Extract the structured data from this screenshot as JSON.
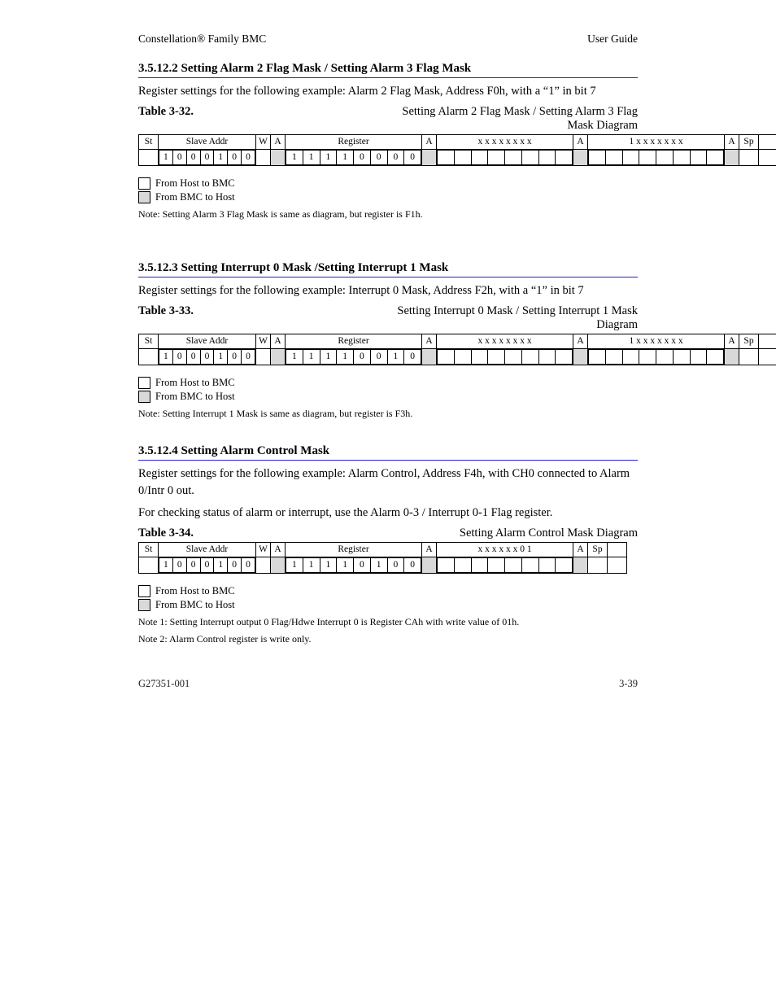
{
  "header": {
    "left": "Constellation®  Family BMC",
    "right": "User Guide"
  },
  "section1": {
    "title": "3.5.12.2   Setting Alarm 2 Flag Mask / Setting Alarm 3 Flag Mask",
    "intro": "Register settings for the following example: Alarm 2 Flag Mask, Address F0h, with a “1” in bit 7",
    "tableLabel": "Table 3-32.",
    "tableTitle": "Setting Alarm 2 Flag Mask / Setting Alarm 3 Flag Mask Diagram",
    "row1": {
      "st": "St",
      "slave": "Slave Addr",
      "rw": "W",
      "a": "A",
      "reg": "Register",
      "regA": "A",
      "byte2": "x x x x x x x x",
      "byte2A": "A",
      "byte3": "1 x x x x x x x",
      "byte3A": "A",
      "sp": "Sp",
      "p": ""
    },
    "bits": {
      "slave": [
        "1",
        "0",
        "0",
        "0",
        "1",
        "0",
        "0"
      ],
      "register": [
        "1",
        "1",
        "1",
        "1",
        "0",
        "0",
        "0",
        "0"
      ]
    },
    "legend": {
      "host": "From Host to BMC",
      "bmc": "From BMC to Host"
    },
    "note": "Note: Setting Alarm 3 Flag Mask is same as diagram, but register is F1h."
  },
  "section2": {
    "title": "3.5.12.3   Setting Interrupt 0 Mask /Setting Interrupt 1 Mask",
    "intro": "Register settings for the following example: Interrupt 0 Mask, Address F2h, with a “1” in bit 7",
    "tableLabel": "Table 3-33.",
    "tableTitle": "Setting Interrupt 0 Mask / Setting Interrupt 1 Mask Diagram",
    "row1": {
      "st": "St",
      "slave": "Slave Addr",
      "rw": "W",
      "a": "A",
      "reg": "Register",
      "regA": "A",
      "byte2": "x x x x x x x x",
      "byte2A": "A",
      "byte3": "1 x x x x x x x",
      "byte3A": "A",
      "sp": "Sp",
      "p": ""
    },
    "bits": {
      "slave": [
        "1",
        "0",
        "0",
        "0",
        "1",
        "0",
        "0"
      ],
      "register": [
        "1",
        "1",
        "1",
        "1",
        "0",
        "0",
        "1",
        "0"
      ]
    },
    "legend": {
      "host": "From Host to BMC",
      "bmc": "From BMC to Host"
    },
    "note": "Note: Setting Interrupt 1 Mask is same as diagram, but register is F3h."
  },
  "section3": {
    "title": "3.5.12.4   Setting Alarm Control Mask",
    "intro_line1": "Register settings for the following example: Alarm Control, Address F4h, with CH0 connected to Alarm 0/Intr 0 out.",
    "intro_line2": "For checking status of alarm or interrupt, use the Alarm 0-3 / Interrupt 0-1 Flag register.",
    "tableLabel": "Table 3-34.",
    "tableTitle": "Setting Alarm Control Mask Diagram",
    "row1": {
      "st": "St",
      "slave": "Slave Addr",
      "rw": "W",
      "a": "A",
      "reg": "Register",
      "regA": "A",
      "byte2": "x x x x x x 0 1",
      "byte2A": "A",
      "sp": "Sp",
      "p": ""
    },
    "bits": {
      "slave": [
        "1",
        "0",
        "0",
        "0",
        "1",
        "0",
        "0"
      ],
      "register": [
        "1",
        "1",
        "1",
        "1",
        "0",
        "1",
        "0",
        "0"
      ]
    },
    "legend": {
      "host": "From Host to BMC",
      "bmc": "From BMC to Host"
    },
    "note1": "Note 1: Setting Interrupt output 0 Flag/Hdwe Interrupt 0 is Register CAh with write value of 01h.",
    "note2": "Note 2: Alarm Control register is write only."
  },
  "footer": {
    "left": "G27351-001",
    "right": "3-39"
  }
}
